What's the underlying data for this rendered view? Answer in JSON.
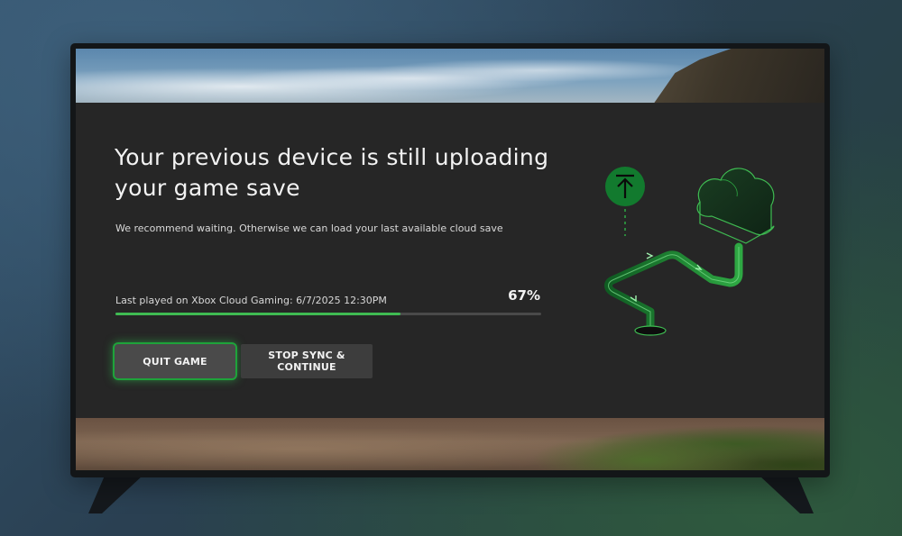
{
  "dialog": {
    "title": "Your previous device is still uploading your game save",
    "subtitle": "We recommend waiting. Otherwise we can load your last available cloud save",
    "last_played": "Last played on Xbox Cloud Gaming: 6/7/2025 12:30PM",
    "progress_label": "67%",
    "progress_value": 0.67,
    "quit_button": "QUIT GAME",
    "stop_sync_button": "STOP SYNC & CONTINUE"
  },
  "illustration": {
    "icons": [
      "upload-arrow-icon",
      "cloud-icon",
      "sync-pipe-icon"
    ]
  },
  "colors": {
    "accent_green": "#3fbb52",
    "focus_glow": "#1ea33a",
    "dialog_background": "#262626",
    "text_primary": "#f2f2f2"
  }
}
